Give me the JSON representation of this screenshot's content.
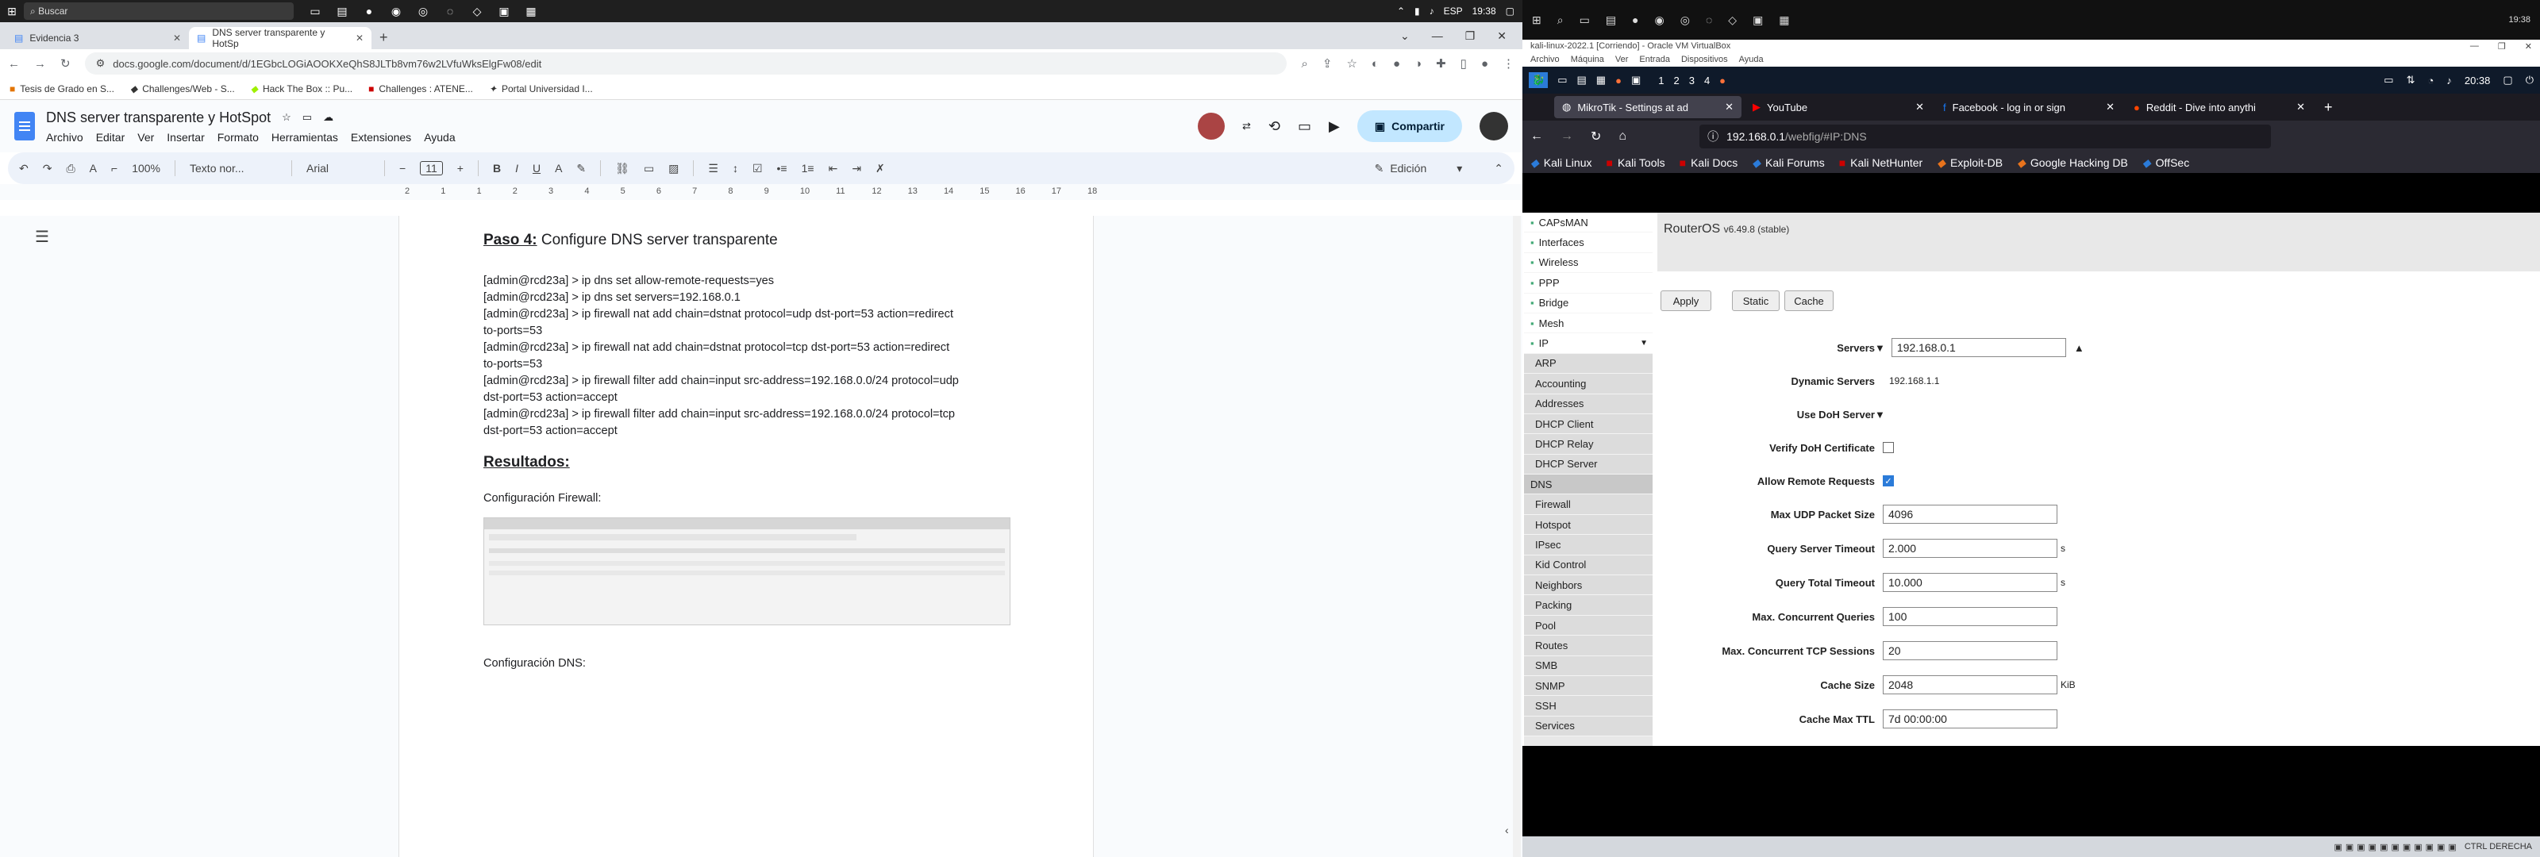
{
  "win_taskbar": {
    "search_placeholder": "Buscar",
    "lang": "ESP",
    "time": "19:38"
  },
  "chrome": {
    "tabs": [
      {
        "label": "Evidencia 3"
      },
      {
        "label": "DNS server transparente y HotSp"
      }
    ],
    "url": "docs.google.com/document/d/1EGbcLOGiAOOKXeQhS8JLTb8vm76w2LVfuWksElgFw08/edit",
    "bookmarks": [
      "Tesis de Grado en S...",
      "Challenges/Web - S...",
      "Hack The Box :: Pu...",
      "Challenges : ATENE...",
      "Portal Universidad I..."
    ]
  },
  "docs": {
    "title": "DNS server transparente y HotSpot",
    "menu": [
      "Archivo",
      "Editar",
      "Ver",
      "Insertar",
      "Formato",
      "Herramientas",
      "Extensiones",
      "Ayuda"
    ],
    "share_label": "Compartir",
    "zoom": "100%",
    "style": "Texto nor...",
    "font": "Arial",
    "font_size": "11",
    "mode": "Edición",
    "ruler_numbers": [
      "2",
      "1",
      "1",
      "2",
      "3",
      "4",
      "5",
      "6",
      "7",
      "8",
      "9",
      "10",
      "11",
      "12",
      "13",
      "14",
      "15",
      "16",
      "17",
      "18"
    ],
    "heading_step": "Paso 4:",
    "heading_rest": " Configure DNS server transparente",
    "lines": [
      "[admin@rcd23a] > ip dns set allow-remote-requests=yes",
      "[admin@rcd23a] > ip dns set servers=192.168.0.1",
      "[admin@rcd23a] > ip firewall nat add chain=dstnat protocol=udp dst-port=53 action=redirect",
      "to-ports=53",
      "[admin@rcd23a] > ip firewall nat add chain=dstnat protocol=tcp dst-port=53 action=redirect",
      "to-ports=53",
      "[admin@rcd23a] > ip firewall filter add chain=input src-address=192.168.0.0/24 protocol=udp",
      "dst-port=53 action=accept",
      "[admin@rcd23a] > ip firewall filter add chain=input src-address=192.168.0.0/24 protocol=tcp",
      "dst-port=53 action=accept"
    ],
    "results_heading": "Resultados:",
    "firewall_caption": "Configuración Firewall:",
    "dns_caption": "Configuración DNS:"
  },
  "vbox": {
    "title": "kali-linux-2022.1 [Corriendo] - Oracle VM VirtualBox",
    "menu": [
      "Archivo",
      "Máquina",
      "Ver",
      "Entrada",
      "Dispositivos",
      "Ayuda"
    ],
    "kali_time": "20:38",
    "workspaces": [
      "1",
      "2",
      "3",
      "4"
    ],
    "host_time": "19:38"
  },
  "firefox": {
    "tabs": [
      {
        "label": "MikroTik - Settings at ad"
      },
      {
        "label": "YouTube"
      },
      {
        "label": "Facebook - log in or sign"
      },
      {
        "label": "Reddit - Dive into anythi"
      }
    ],
    "url_host": "192.168.0.1",
    "url_path": "/webfig/#IP:DNS",
    "bookmarks": [
      "Kali Linux",
      "Kali Tools",
      "Kali Docs",
      "Kali Forums",
      "Kali NetHunter",
      "Exploit-DB",
      "Google Hacking DB",
      "OffSec"
    ]
  },
  "webfig": {
    "product": "RouterOS",
    "version": "v6.49.8 (stable)",
    "menu": [
      {
        "label": "CAPsMAN",
        "type": "top"
      },
      {
        "label": "Interfaces",
        "type": "top"
      },
      {
        "label": "Wireless",
        "type": "top"
      },
      {
        "label": "PPP",
        "type": "top"
      },
      {
        "label": "Bridge",
        "type": "top"
      },
      {
        "label": "Mesh",
        "type": "top"
      },
      {
        "label": "IP",
        "type": "top"
      },
      {
        "label": "ARP",
        "type": "sub"
      },
      {
        "label": "Accounting",
        "type": "sub"
      },
      {
        "label": "Addresses",
        "type": "sub"
      },
      {
        "label": "DHCP Client",
        "type": "sub"
      },
      {
        "label": "DHCP Relay",
        "type": "sub"
      },
      {
        "label": "DHCP Server",
        "type": "sub"
      },
      {
        "label": "DNS",
        "type": "sel"
      },
      {
        "label": "Firewall",
        "type": "sub"
      },
      {
        "label": "Hotspot",
        "type": "sub"
      },
      {
        "label": "IPsec",
        "type": "sub"
      },
      {
        "label": "Kid Control",
        "type": "sub"
      },
      {
        "label": "Neighbors",
        "type": "sub"
      },
      {
        "label": "Packing",
        "type": "sub"
      },
      {
        "label": "Pool",
        "type": "sub"
      },
      {
        "label": "Routes",
        "type": "sub"
      },
      {
        "label": "SMB",
        "type": "sub"
      },
      {
        "label": "SNMP",
        "type": "sub"
      },
      {
        "label": "SSH",
        "type": "sub"
      },
      {
        "label": "Services",
        "type": "sub"
      }
    ],
    "buttons": {
      "apply": "Apply",
      "static": "Static",
      "cache": "Cache"
    },
    "fields": {
      "servers": {
        "label": "Servers",
        "value": "192.168.0.1"
      },
      "dynamic_servers": {
        "label": "Dynamic Servers",
        "value": "192.168.1.1"
      },
      "use_doh": {
        "label": "Use DoH Server"
      },
      "verify_doh": {
        "label": "Verify DoH Certificate",
        "checked": false
      },
      "allow_remote": {
        "label": "Allow Remote Requests",
        "checked": true
      },
      "max_udp": {
        "label": "Max UDP Packet Size",
        "value": "4096"
      },
      "query_server_timeout": {
        "label": "Query Server Timeout",
        "value": "2.000",
        "unit": "s"
      },
      "query_total_timeout": {
        "label": "Query Total Timeout",
        "value": "10.000",
        "unit": "s"
      },
      "max_conc_queries": {
        "label": "Max. Concurrent Queries",
        "value": "100"
      },
      "max_conc_tcp": {
        "label": "Max. Concurrent TCP Sessions",
        "value": "20"
      },
      "cache_size": {
        "label": "Cache Size",
        "value": "2048",
        "unit": "KiB"
      },
      "cache_max_ttl": {
        "label": "Cache Max TTL",
        "value": "7d 00:00:00"
      }
    }
  },
  "host_tray": {
    "label": "CTRL DERECHA"
  }
}
